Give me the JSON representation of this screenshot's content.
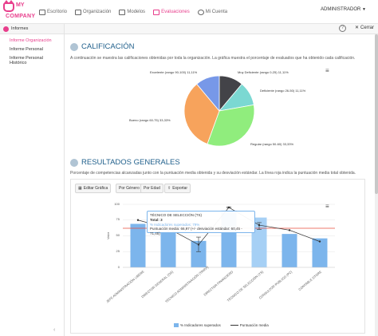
{
  "app": {
    "logo_line1": "MY",
    "logo_line2": "COMPANY"
  },
  "nav": {
    "items": [
      {
        "label": "Escritorio",
        "icon": "desktop-icon"
      },
      {
        "label": "Organización",
        "icon": "org-chart-icon"
      },
      {
        "label": "Modelos",
        "icon": "models-icon"
      },
      {
        "label": "Evaluaciones",
        "icon": "chart-icon",
        "active": true
      },
      {
        "label": "Mi Cuenta",
        "icon": "gear-icon"
      }
    ],
    "user": "ADMINISTRADOR"
  },
  "sidebar": {
    "header": "Informes",
    "items": [
      {
        "label": "Informe Organización",
        "active": true
      },
      {
        "label": "Informe Personal"
      },
      {
        "label": "Informe Personal Histórico"
      }
    ],
    "collapse": "‹"
  },
  "crumbbar": {
    "help": "?",
    "close_label": "Cerrar"
  },
  "calificacion": {
    "title": "CALIFICACIÓN",
    "description": "A continuación se muestra las calificaciones obtenidas por toda la organización. La gráfica muestra el porcentaje de evaluados que ha obtenido cada calificación.",
    "menu": "≡"
  },
  "resultados": {
    "title": "RESULTADOS GENERALES",
    "description": "Porcentaje de competencias alcanzadas junto con la puntuación media obtenida y su desviación estándar. La línea roja indica la puntuación media total obtenida.",
    "buttons": {
      "edit": "Editar Gráfica",
      "by_gender": "Por Género",
      "by_age": "Por Edad",
      "export": "Exportar"
    },
    "menu": "≡"
  },
  "tooltip": {
    "title": "TÉCNICO DE SELECCIÓN (TS)",
    "total": "Total: 3",
    "line2": "% Indicadores superados: 79%",
    "line3": "Puntuación media: 66,97 (+/- desviación estándar: 60,45 - 71,45)"
  },
  "colors": {
    "accent": "#e83e8c",
    "title_blue": "#1f5f8b",
    "bar_blue": "#7cb5ec",
    "slice_excelente": "#7798e8",
    "slice_muy_deficiente": "#434348",
    "slice_deficiente": "#90ed7d",
    "slice_regular": "#90ed7d",
    "slice_bueno": "#f7a35c",
    "red_line": "#e74c3c"
  },
  "chart_data": [
    {
      "type": "pie",
      "slices": [
        {
          "label": "Muy Deficiente (rango 0-25)",
          "value": 11.11,
          "display": "11,11%",
          "color": "#434348"
        },
        {
          "label": "Deficiente (rango 26-50)",
          "value": 11.11,
          "display": "11,11%",
          "color": "#90ed7d"
        },
        {
          "label": "Regular (rango 50-60)",
          "value": 33.33,
          "display": "33,33%",
          "color": "#90ed7d"
        },
        {
          "label": "Bueno (rango 60-75)",
          "value": 33.33,
          "display": "33,33%",
          "color": "#f7a35c"
        },
        {
          "label": "Excelente (rango 90-100)",
          "value": 11.11,
          "display": "11,11%",
          "color": "#7798e8"
        }
      ]
    },
    {
      "type": "bar",
      "categories": [
        "JEFE ADMINISTRACIÓN LIBERE",
        "DIRECTOR GENERAL (DG)",
        "TÉCNICO ADMINISTRACIÓN (TAMVI)",
        "DIRECTOR FINANCIERO",
        "TÉCNICO DE SELECCIÓN (TS)",
        "CONSULTOR PÚBLICO (PC)",
        "CONTABLE DTORE"
      ],
      "series": [
        {
          "name": "% Indicadores superados",
          "type": "bar",
          "values": [
            69,
            57,
            42,
            90,
            79,
            53,
            46
          ]
        },
        {
          "name": "Puntuación media",
          "type": "line",
          "values": [
            75,
            62,
            36,
            95,
            67,
            59,
            41
          ],
          "error_low": [
            75,
            55,
            25,
            94,
            60,
            59,
            41
          ],
          "error_high": [
            75,
            70,
            48,
            96,
            71,
            59,
            41
          ]
        }
      ],
      "reference_line": 62,
      "ylim": [
        0,
        100
      ],
      "yticks": [
        "0",
        "25",
        "50",
        "75",
        "100"
      ],
      "ylabel": "Valor"
    }
  ]
}
